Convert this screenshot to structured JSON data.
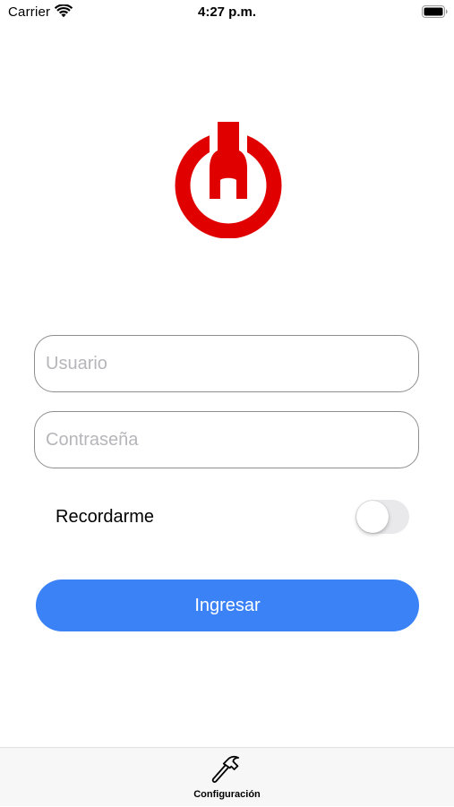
{
  "status_bar": {
    "carrier": "Carrier",
    "time": "4:27 p.m.",
    "icons": [
      "wifi-icon",
      "battery-icon"
    ]
  },
  "logo": {
    "icon": "power-wrench-logo",
    "color": "#e00000"
  },
  "form": {
    "username_placeholder": "Usuario",
    "username_value": "",
    "password_placeholder": "Contraseña",
    "password_value": "",
    "remember_label": "Recordarme",
    "remember_enabled": false,
    "submit_label": "Ingresar"
  },
  "tab_bar": {
    "items": [
      {
        "label": "Configuración",
        "icon": "hammer-icon"
      }
    ]
  },
  "colors": {
    "accent": "#3b82f6",
    "logo_red": "#e00000",
    "field_border": "#8e8e8e",
    "placeholder": "#b6b6ba",
    "toggle_off": "#e9e9eb",
    "tab_bar_bg": "#f7f7f7"
  }
}
